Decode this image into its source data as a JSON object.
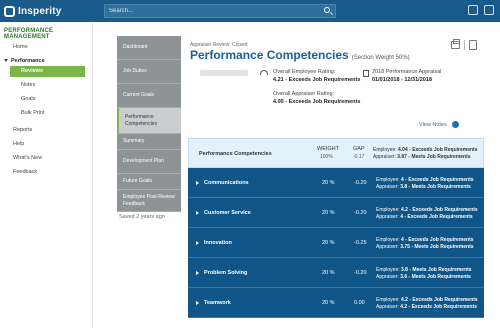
{
  "app": {
    "logo_text": "Insperity",
    "search_placeholder": "Search..."
  },
  "leftnav": {
    "heading": "PERFORMANCE MANAGEMENT",
    "home": "Home",
    "performance": "Performance",
    "reviews": "Reviews",
    "notes": "Notes",
    "goals": "Goals",
    "bulk_print": "Bulk Print",
    "reports": "Reports",
    "help": "Help",
    "whats_new": "What's New",
    "feedback": "Feedback"
  },
  "review_menu": {
    "items": [
      "Dashboard",
      "Job Duties",
      "Current Goals",
      "Performance Competencies",
      "Summary",
      "Development Plan",
      "Future Goals",
      "Employee Post-Review Feedback"
    ],
    "saved_text": "Saved 2 years ago"
  },
  "main": {
    "appraiser_review": "Appraiser Review: Closed",
    "title": "Performance Competencies",
    "section_weight": "(Section Weight 50%)",
    "overall_employee_label": "Overall Employee Rating:",
    "overall_employee_value": "4.21 - Exceeds Job Requirements",
    "overall_appraiser_label": "Overall Appraiser Rating:",
    "overall_appraiser_value": "4.00 - Exceeds Job Requirements",
    "appraisal_label": "2018 Performance Appraisal",
    "appraisal_dates": "01/01/2018 - 12/31/2018",
    "view_notes": "View Notes"
  },
  "table": {
    "header": {
      "title": "Performance Competencies",
      "weight_label": "WEIGHT",
      "weight_value": "100%",
      "gap_label": "GAP",
      "gap_value": "-0.17",
      "employee_label": "Employee:",
      "employee_value": "4.04 - Exceeds Job Requirements",
      "appraiser_label": "Appraiser:",
      "appraiser_value": "3.87 - Meets Job Requirements"
    },
    "rows": [
      {
        "name": "Communications",
        "weight": "20 %",
        "gap": "-0.20",
        "employee": "4 - Exceeds Job Requirements",
        "appraiser": "3.8 - Meets Job Requirements"
      },
      {
        "name": "Customer Service",
        "weight": "20 %",
        "gap": "-0.20",
        "employee": "4.2 - Exceeds Job Requirements",
        "appraiser": "4 - Exceeds Job Requirements"
      },
      {
        "name": "Innovation",
        "weight": "20 %",
        "gap": "-0.25",
        "employee": "4 - Exceeds Job Requirements",
        "appraiser": "3.75 - Meets Job Requirements"
      },
      {
        "name": "Problem Solving",
        "weight": "20 %",
        "gap": "-0.20",
        "employee": "3.8 - Meets Job Requirements",
        "appraiser": "3.6 - Meets Job Requirements"
      },
      {
        "name": "Teamwork",
        "weight": "20 %",
        "gap": "0.00",
        "employee": "4.2 - Exceeds Job Requirements",
        "appraiser": "4.2 - Exceeds Job Requirements"
      }
    ]
  }
}
